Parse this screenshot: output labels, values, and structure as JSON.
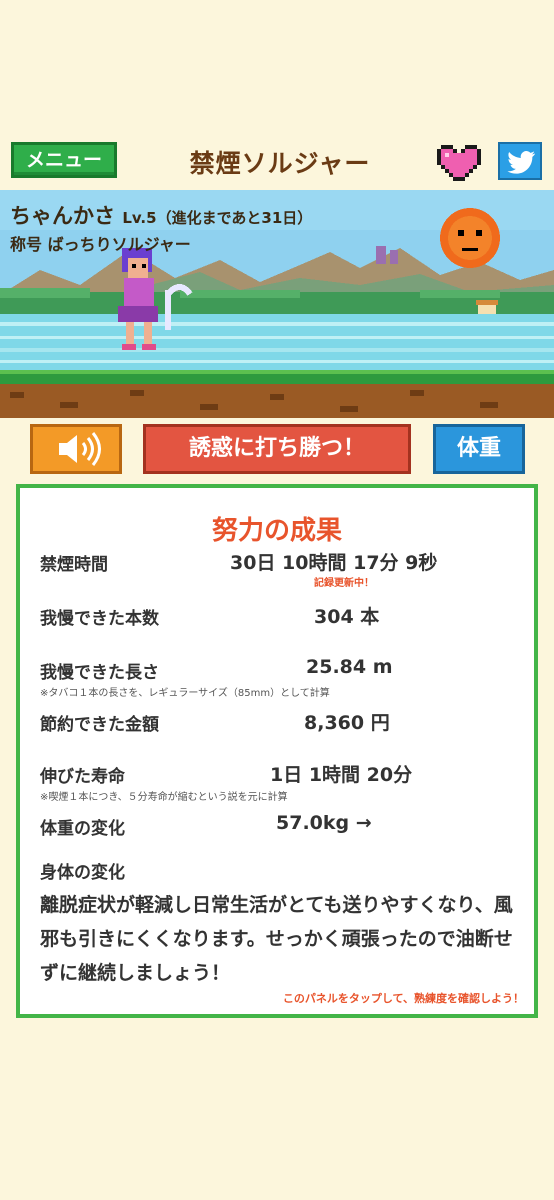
{
  "header": {
    "menu_label": "メニュー",
    "title": "禁煙ソルジャー",
    "heart_icon": "heart-icon",
    "twitter_icon": "twitter-icon"
  },
  "character": {
    "name": "ちゃんかさ",
    "level": "Lv.5",
    "evolution": "（進化まであと31日）",
    "title": "称号 ばっちりソルジャー"
  },
  "actions": {
    "sound_icon": "speaker-icon",
    "resist_label": "誘惑に打ち勝つ！",
    "weight_label": "体重"
  },
  "results": {
    "title": "努力の成果",
    "quit_time": {
      "label": "禁煙時間",
      "value": "30日  10時間  17分  9秒",
      "note": "記録更新中！"
    },
    "cigarettes": {
      "label": "我慢できた本数",
      "value": "304  本"
    },
    "length": {
      "label": "我慢できた長さ",
      "value": "25.84  m",
      "note": "※タバコ１本の長さを、レギュラーサイズ（85mm）として計算"
    },
    "money": {
      "label": "節約できた金額",
      "value": "8,360  円"
    },
    "life": {
      "label": "伸びた寿命",
      "value": "1日  1時間  20分",
      "note": "※喫煙１本につき、５分寿命が縮むという説を元に計算"
    },
    "weight": {
      "label": "体重の変化",
      "value": "57.0kg  →"
    },
    "body": {
      "label": "身体の変化",
      "text": "離脱症状が軽減し日常生活がとても送りやすくなり、風邪も引きにくくなります。せっかく頑張ったので油断せずに継続しましょう！"
    },
    "footer": "このパネルをタップして、熟練度を確認しよう！"
  }
}
